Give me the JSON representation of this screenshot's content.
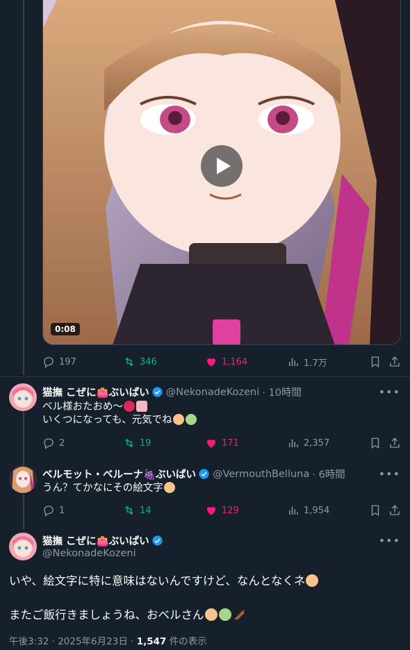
{
  "first_tweet": {
    "video_duration": "0:08",
    "stats": {
      "replies": "197",
      "retweets": "346",
      "likes": "1,164",
      "views": "1.7万"
    }
  },
  "reply1": {
    "name": "猫撫 こぜに👛ぶいぱい",
    "handle": "@NekonadeKozeni",
    "time": "· 10時間",
    "line1": "ベル様おたおめ～",
    "line2": "いくつになっても、元気でね",
    "stats": {
      "replies": "2",
      "retweets": "19",
      "likes": "171",
      "views": "2,357"
    }
  },
  "reply2": {
    "name": "ベルモット・ベルーナ🍇ぶいぱい",
    "handle": "@VermouthBelluna",
    "time": "· 6時間",
    "line1": "うん？てかなにその絵文字",
    "stats": {
      "replies": "1",
      "retweets": "14",
      "likes": "129",
      "views": "1,954"
    }
  },
  "main_tweet": {
    "name": "猫撫 こぜに👛ぶいぱい",
    "handle": "@NekonadeKozeni",
    "line1": "いや、絵文字に特に意味はないんですけど、なんとなくネ",
    "line2": "またご飯行きましょうね、おベルさん",
    "time": "午後3:32 · 2025年6月23日 · ",
    "views_count": "1,547",
    "views_label": " 件の表示"
  },
  "colors": {
    "background": "#15202b",
    "retweet": "#00ba7c",
    "like": "#f91880",
    "verified": "#1d9bf0",
    "muted": "#8b98a5"
  },
  "icons": [
    "reply-icon",
    "retweet-icon",
    "heart-icon",
    "views-icon",
    "bookmark-icon",
    "share-icon",
    "more-icon",
    "verified-badge-icon"
  ]
}
